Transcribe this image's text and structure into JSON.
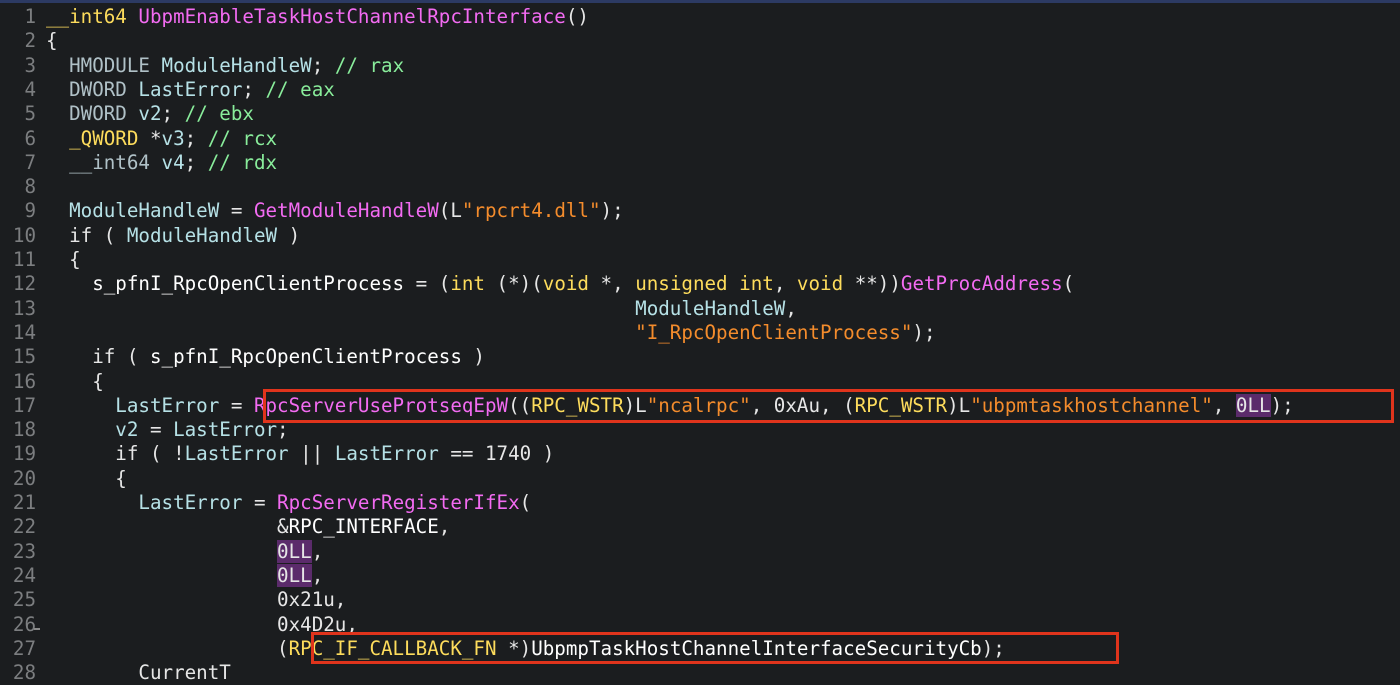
{
  "editor": {
    "lines": [
      {
        "n": "1",
        "tokens": [
          {
            "t": "__int64 ",
            "c": "kw"
          },
          {
            "t": "UbpmEnableTaskHostChannelRpcInterface",
            "c": "fn"
          },
          {
            "t": "()",
            "c": "sym"
          }
        ]
      },
      {
        "n": "2",
        "tokens": [
          {
            "t": "{",
            "c": "sym"
          }
        ]
      },
      {
        "n": "3",
        "tokens": [
          {
            "t": "  HMODULE ",
            "c": "type"
          },
          {
            "t": "ModuleHandleW",
            "c": "var"
          },
          {
            "t": "; ",
            "c": "sym"
          },
          {
            "t": "// rax",
            "c": "cmt"
          }
        ]
      },
      {
        "n": "4",
        "tokens": [
          {
            "t": "  DWORD ",
            "c": "type"
          },
          {
            "t": "LastError",
            "c": "var"
          },
          {
            "t": "; ",
            "c": "sym"
          },
          {
            "t": "// eax",
            "c": "cmt"
          }
        ]
      },
      {
        "n": "5",
        "tokens": [
          {
            "t": "  DWORD ",
            "c": "type"
          },
          {
            "t": "v2",
            "c": "var"
          },
          {
            "t": "; ",
            "c": "sym"
          },
          {
            "t": "// ebx",
            "c": "cmt"
          }
        ]
      },
      {
        "n": "6",
        "tokens": [
          {
            "t": "  _QWORD ",
            "c": "kw"
          },
          {
            "t": "*",
            "c": "sym"
          },
          {
            "t": "v3",
            "c": "var"
          },
          {
            "t": "; ",
            "c": "sym"
          },
          {
            "t": "// rcx",
            "c": "cmt"
          }
        ]
      },
      {
        "n": "7",
        "tokens": [
          {
            "t": "  __int64 ",
            "c": "type"
          },
          {
            "t": "v4",
            "c": "var"
          },
          {
            "t": "; ",
            "c": "sym"
          },
          {
            "t": "// rdx",
            "c": "cmt"
          }
        ]
      },
      {
        "n": "8",
        "tokens": []
      },
      {
        "n": "9",
        "tokens": [
          {
            "t": "  ModuleHandleW",
            "c": "var"
          },
          {
            "t": " = ",
            "c": "sym"
          },
          {
            "t": "GetModuleHandleW",
            "c": "gfn"
          },
          {
            "t": "(",
            "c": "sym"
          },
          {
            "t": "L",
            "c": "sym"
          },
          {
            "t": "\"rpcrt4.dll\"",
            "c": "str"
          },
          {
            "t": ");",
            "c": "sym"
          }
        ]
      },
      {
        "n": "10",
        "tokens": [
          {
            "t": "  if ( ",
            "c": "sym"
          },
          {
            "t": "ModuleHandleW",
            "c": "var"
          },
          {
            "t": " )",
            "c": "sym"
          }
        ]
      },
      {
        "n": "11",
        "tokens": [
          {
            "t": "  {",
            "c": "sym"
          }
        ]
      },
      {
        "n": "12",
        "tokens": [
          {
            "t": "    s_pfnI_RpcOpenClientProcess",
            "c": "glob"
          },
          {
            "t": " = (",
            "c": "sym"
          },
          {
            "t": "int ",
            "c": "kw"
          },
          {
            "t": "(*)(",
            "c": "sym"
          },
          {
            "t": "void ",
            "c": "kw"
          },
          {
            "t": "*, ",
            "c": "sym"
          },
          {
            "t": "unsigned int",
            "c": "kw"
          },
          {
            "t": ", ",
            "c": "sym"
          },
          {
            "t": "void ",
            "c": "kw"
          },
          {
            "t": "**))",
            "c": "sym"
          },
          {
            "t": "GetProcAddress",
            "c": "gfn"
          },
          {
            "t": "(",
            "c": "sym"
          }
        ]
      },
      {
        "n": "13",
        "tokens": [
          {
            "t": "                                                   ",
            "c": "sym"
          },
          {
            "t": "ModuleHandleW",
            "c": "var"
          },
          {
            "t": ",",
            "c": "sym"
          }
        ]
      },
      {
        "n": "14",
        "tokens": [
          {
            "t": "                                                   ",
            "c": "sym"
          },
          {
            "t": "\"I_RpcOpenClientProcess\"",
            "c": "str"
          },
          {
            "t": ");",
            "c": "sym"
          }
        ]
      },
      {
        "n": "15",
        "tokens": [
          {
            "t": "    if ( ",
            "c": "sym"
          },
          {
            "t": "s_pfnI_RpcOpenClientProcess",
            "c": "glob"
          },
          {
            "t": " )",
            "c": "sym"
          }
        ]
      },
      {
        "n": "16",
        "tokens": [
          {
            "t": "    {",
            "c": "sym"
          }
        ]
      },
      {
        "n": "17",
        "tokens": [
          {
            "t": "      LastError",
            "c": "var"
          },
          {
            "t": " = ",
            "c": "sym"
          },
          {
            "t": "RpcServerUseProtseqEpW",
            "c": "gfn"
          },
          {
            "t": "((",
            "c": "sym"
          },
          {
            "t": "RPC_WSTR",
            "c": "kw"
          },
          {
            "t": ")L",
            "c": "sym"
          },
          {
            "t": "\"ncalrpc\"",
            "c": "str"
          },
          {
            "t": ", 0xAu, (",
            "c": "sym"
          },
          {
            "t": "RPC_WSTR",
            "c": "kw"
          },
          {
            "t": ")L",
            "c": "sym"
          },
          {
            "t": "\"ubpmtaskhostchannel\"",
            "c": "str"
          },
          {
            "t": ", ",
            "c": "sym"
          },
          {
            "t": "0LL",
            "c": "hl"
          },
          {
            "t": ");",
            "c": "sym"
          }
        ]
      },
      {
        "n": "18",
        "tokens": [
          {
            "t": "      v2",
            "c": "var"
          },
          {
            "t": " = ",
            "c": "sym"
          },
          {
            "t": "LastError",
            "c": "var"
          },
          {
            "t": ";",
            "c": "sym"
          }
        ]
      },
      {
        "n": "19",
        "tokens": [
          {
            "t": "      if ( !",
            "c": "sym"
          },
          {
            "t": "LastError",
            "c": "var"
          },
          {
            "t": " || ",
            "c": "sym"
          },
          {
            "t": "LastError",
            "c": "var"
          },
          {
            "t": " == 1740 )",
            "c": "sym"
          }
        ]
      },
      {
        "n": "20",
        "tokens": [
          {
            "t": "      {",
            "c": "sym"
          }
        ]
      },
      {
        "n": "21",
        "tokens": [
          {
            "t": "        LastError",
            "c": "var"
          },
          {
            "t": " = ",
            "c": "sym"
          },
          {
            "t": "RpcServerRegisterIfEx",
            "c": "gfn"
          },
          {
            "t": "(",
            "c": "sym"
          }
        ]
      },
      {
        "n": "22",
        "tokens": [
          {
            "t": "                    &",
            "c": "sym"
          },
          {
            "t": "RPC_INTERFACE",
            "c": "glob"
          },
          {
            "t": ",",
            "c": "sym"
          }
        ]
      },
      {
        "n": "23",
        "tokens": [
          {
            "t": "                    ",
            "c": "sym"
          },
          {
            "t": "0LL",
            "c": "hl"
          },
          {
            "t": ",",
            "c": "sym"
          }
        ]
      },
      {
        "n": "24",
        "tokens": [
          {
            "t": "                    ",
            "c": "sym"
          },
          {
            "t": "0LL",
            "c": "hl"
          },
          {
            "t": ",",
            "c": "sym"
          }
        ]
      },
      {
        "n": "25",
        "tokens": [
          {
            "t": "                    0x21u,",
            "c": "sym"
          }
        ]
      },
      {
        "n": "26",
        "tokens": [
          {
            "t": "                    0x4D2u,",
            "c": "sym"
          }
        ]
      },
      {
        "n": "27",
        "tokens": [
          {
            "t": "                    (",
            "c": "sym"
          },
          {
            "t": "RPC_IF_CALLBACK_FN ",
            "c": "kw"
          },
          {
            "t": "*)",
            "c": "sym"
          },
          {
            "t": "UbpmpTaskHostChannelInterfaceSecurityCb",
            "c": "glob"
          },
          {
            "t": ");",
            "c": "sym"
          }
        ]
      },
      {
        "n": "28",
        "tokens": [
          {
            "t": "        CurrentT",
            "c": "sym"
          }
        ]
      }
    ]
  },
  "annotations": {
    "box_color": "#e0341c"
  }
}
